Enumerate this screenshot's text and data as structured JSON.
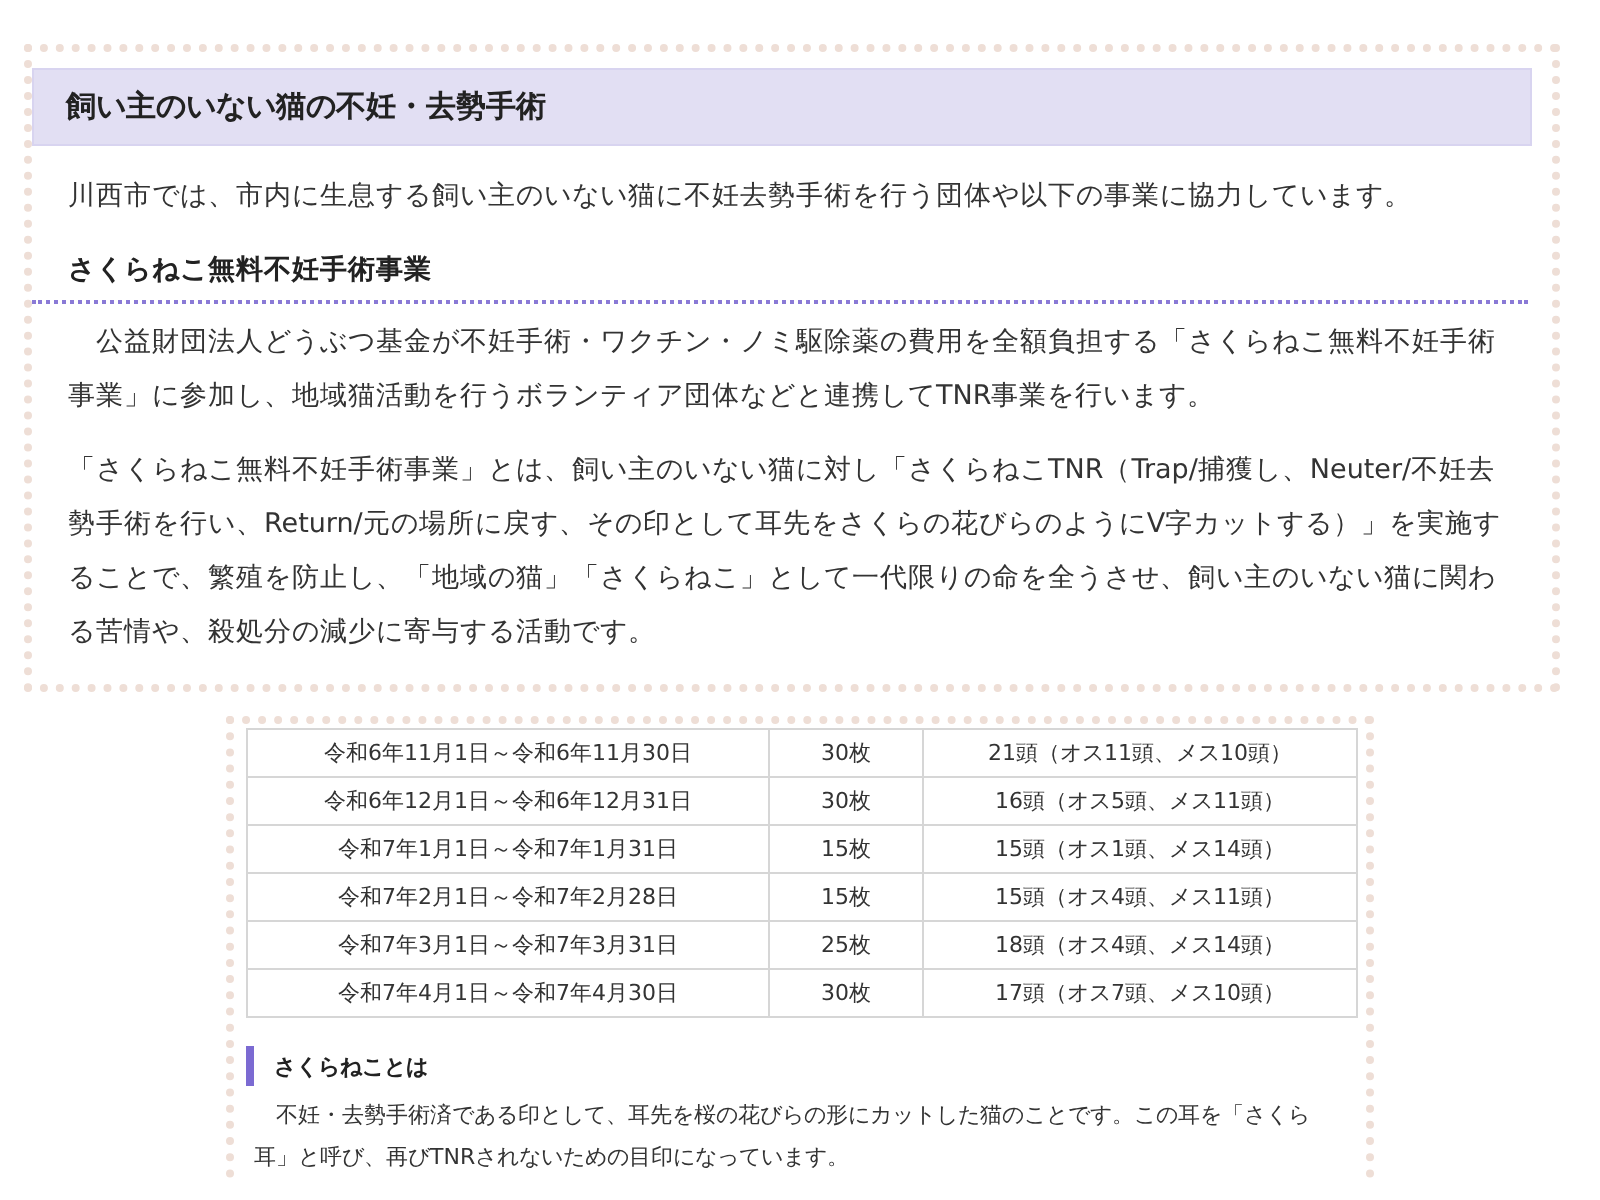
{
  "section": {
    "title": "飼い主のいない猫の不妊・去勢手術",
    "intro": "川西市では、市内に生息する飼い主のいない猫に不妊去勢手術を行う団体や以下の事業に協力しています。",
    "subheading": "さくらねこ無料不妊手術事業",
    "paragraphs": [
      "　公益財団法人どうぶつ基金が不妊手術・ワクチン・ノミ駆除薬の費用を全額負担する「さくらねこ無料不妊手術事業」に参加し、地域猫活動を行うボランティア団体などと連携してTNR事業を行います。",
      "「さくらねこ無料不妊手術事業」とは、飼い主のいない猫に対し「さくらねこTNR（Trap/捕獲し、Neuter/不妊去勢手術を行い、Return/元の場所に戻す、その印として耳先をさくらの花びらのようにV字カットする）」を実施することで、繁殖を防止し、「地域の猫」「さくらねこ」として一代限りの命を全うさせ、飼い主のいない猫に関わる苦情や、殺処分の減少に寄与する活動です。"
    ]
  },
  "table": {
    "rows": [
      [
        "令和6年11月1日～令和6年11月30日",
        "30枚",
        "21頭（オス11頭、メス10頭）"
      ],
      [
        "令和6年12月1日～令和6年12月31日",
        "30枚",
        "16頭（オス5頭、メス11頭）"
      ],
      [
        "令和7年1月1日～令和7年1月31日",
        "15枚",
        "15頭（オス1頭、メス14頭）"
      ],
      [
        "令和7年2月1日～令和7年2月28日",
        "15枚",
        "15頭（オス4頭、メス11頭）"
      ],
      [
        "令和7年3月1日～令和7年3月31日",
        "25枚",
        "18頭（オス4頭、メス14頭）"
      ],
      [
        "令和7年4月1日～令和7年4月30日",
        "30枚",
        "17頭（オス7頭、メス10頭）"
      ]
    ]
  },
  "note": {
    "title": "さくらねことは",
    "text": "　不妊・去勢手術済である印として、耳先を桜の花びらの形にカットした猫のことです。この耳を「さくら耳」と呼び、再びTNRされないための目印になっています。"
  }
}
